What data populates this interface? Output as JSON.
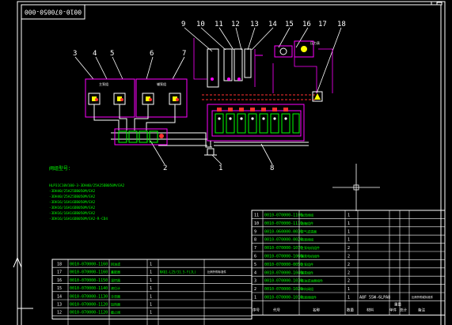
{
  "drawing_number": "0010-070050-000",
  "callouts": [
    "1",
    "2",
    "3",
    "4",
    "5",
    "6",
    "7",
    "8",
    "9",
    "10",
    "11",
    "12",
    "13",
    "14",
    "15",
    "16",
    "17",
    "18"
  ],
  "component_labels": {
    "pump_group_left": "主泵组",
    "pump_group_right": "辅泵组",
    "gauge": "压力表"
  },
  "notes": {
    "title": "阀组型号：",
    "lines": [
      "HLP31C10V100-3-3DH40/25A25DB050M/EA2",
      "-3DH40/25A25DB050M/EA2",
      "-3DH40/25A25DB050M/EA2",
      "-3DH16/16A16DB050M/EA2",
      "-3DH16/16A16DB050M/EA2",
      "-3DH16/16A16DB050M/EA2",
      "-3DH16/16A16DB050M/EA2-R-CD4"
    ]
  },
  "bom_right": {
    "rows": [
      {
        "no": "11",
        "code": "0010-070000-1100",
        "name": "溢流阀组",
        "qty": "1",
        "remark": ""
      },
      {
        "no": "10",
        "code": "0010-070000-1110",
        "name": "油箱组件",
        "qty": "1",
        "remark": ""
      },
      {
        "no": "9",
        "code": "0010-060000-0030",
        "name": "空气滤清器",
        "qty": "1",
        "remark": ""
      },
      {
        "no": "8",
        "code": "0010-070000-0020",
        "name": "电液阀组",
        "qty": "1",
        "remark": ""
      },
      {
        "no": "7",
        "code": "0010-070000-1070",
        "name": "主泵电机组件",
        "qty": "2",
        "remark": ""
      },
      {
        "no": "6",
        "code": "0010-070000-1060",
        "name": "辅泵电机组件",
        "qty": "2",
        "remark": ""
      },
      {
        "no": "5",
        "code": "0010-070000-0050",
        "name": "主泵组件",
        "qty": "2",
        "remark": ""
      },
      {
        "no": "4",
        "code": "0010-070000-1040",
        "name": "辅泵组件",
        "qty": "2",
        "remark": ""
      },
      {
        "no": "3",
        "code": "0010-070000-1030",
        "name": "吸油滤油器组件",
        "qty": "2",
        "remark": ""
      },
      {
        "no": "2",
        "code": "0010-070000-1020",
        "name": "单向阀组",
        "qty": "1",
        "remark": ""
      },
      {
        "no": "1",
        "code": "0010-070000-1010",
        "name": "电液阀组件",
        "qty": "1",
        "remark": "A8F 55W-6LPA8"
      }
    ],
    "header": [
      "序号",
      "代号",
      "名称",
      "数量",
      "材料",
      "单件",
      "总计",
      "备注"
    ],
    "header_extra": "重量",
    "side_note": "比例外购或标准件"
  },
  "bom_left": {
    "rows": [
      {
        "no": "18",
        "code": "0010-070000-1160",
        "name": "回油滤",
        "qty": "1",
        "remark": ""
      },
      {
        "no": "17",
        "code": "0010-070000-1160",
        "name": "蓄能器",
        "qty": "1",
        "remark": "NXQ1-L25/31.5-Y(JL)"
      },
      {
        "no": "16",
        "code": "0010-070000-1150",
        "name": "温控器",
        "qty": "1",
        "remark": ""
      },
      {
        "no": "15",
        "code": "0010-070000-1140",
        "name": "液位计",
        "qty": "1",
        "remark": ""
      },
      {
        "no": "14",
        "code": "0010-070000-1130",
        "name": "冷却器",
        "qty": "1",
        "remark": ""
      },
      {
        "no": "13",
        "code": "0010-070000-1120",
        "name": "加热器",
        "qty": "1",
        "remark": ""
      },
      {
        "no": "12",
        "code": "0010-070000-1120",
        "name": "截止阀",
        "qty": "1",
        "remark": ""
      }
    ],
    "side_note": "比例外购标准件"
  },
  "colors": {
    "background": "#000000",
    "frame": "#ffffff",
    "main_line": "#ffffff",
    "magenta": "#ff00ff",
    "red": "#ff3030",
    "green": "#00ff00",
    "yellow": "#ffff00",
    "cyan": "#00ffff"
  }
}
